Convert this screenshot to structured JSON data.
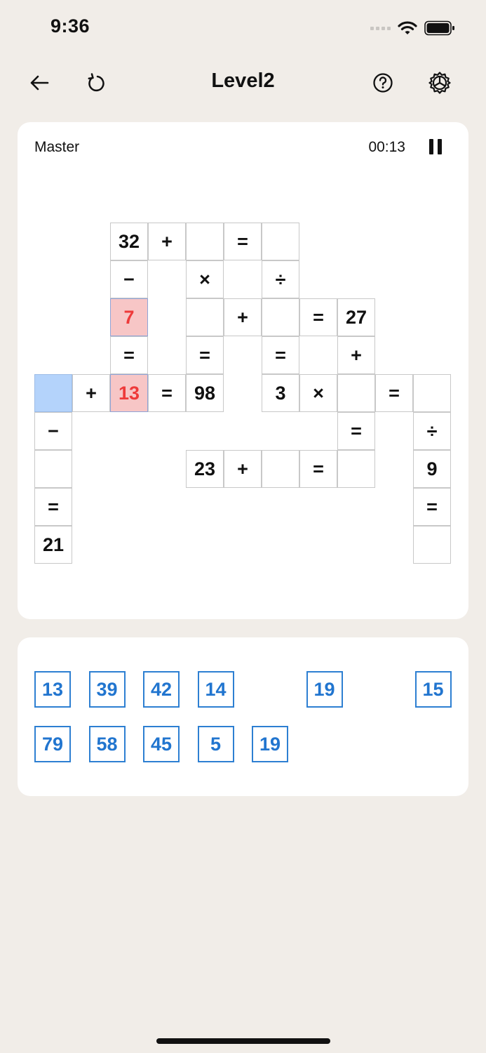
{
  "status_bar": {
    "time": "9:36"
  },
  "header": {
    "title": "Level2"
  },
  "game": {
    "difficulty": "Master",
    "timer": "00:13"
  },
  "board": [
    {
      "id": "r0c2",
      "v": "32",
      "s": ""
    },
    {
      "id": "r0c3",
      "v": "+",
      "s": ""
    },
    {
      "id": "r0c4",
      "v": "",
      "s": ""
    },
    {
      "id": "r0c5",
      "v": "=",
      "s": ""
    },
    {
      "id": "r0c6",
      "v": "",
      "s": ""
    },
    {
      "id": "r1c2",
      "v": "−",
      "s": ""
    },
    {
      "id": "r1c4",
      "v": "×",
      "s": ""
    },
    {
      "id": "r1c6",
      "v": "÷",
      "s": ""
    },
    {
      "id": "r2c2",
      "v": "7",
      "s": "err"
    },
    {
      "id": "r2c4",
      "v": "",
      "s": ""
    },
    {
      "id": "r2c5",
      "v": "+",
      "s": ""
    },
    {
      "id": "r2c6",
      "v": "",
      "s": ""
    },
    {
      "id": "r2c7",
      "v": "=",
      "s": ""
    },
    {
      "id": "r2c8",
      "v": "27",
      "s": ""
    },
    {
      "id": "r3c2",
      "v": "=",
      "s": ""
    },
    {
      "id": "r3c4",
      "v": "=",
      "s": ""
    },
    {
      "id": "r3c6",
      "v": "=",
      "s": ""
    },
    {
      "id": "r3c8",
      "v": "+",
      "s": ""
    },
    {
      "id": "r4c0",
      "v": "",
      "s": "sel"
    },
    {
      "id": "r4c1",
      "v": "+",
      "s": ""
    },
    {
      "id": "r4c2",
      "v": "13",
      "s": "err"
    },
    {
      "id": "r4c3",
      "v": "=",
      "s": ""
    },
    {
      "id": "r4c4",
      "v": "98",
      "s": ""
    },
    {
      "id": "r4c6",
      "v": "3",
      "s": ""
    },
    {
      "id": "r4c7",
      "v": "×",
      "s": ""
    },
    {
      "id": "r4c8",
      "v": "",
      "s": ""
    },
    {
      "id": "r4c9",
      "v": "=",
      "s": ""
    },
    {
      "id": "r4c10",
      "v": "",
      "s": ""
    },
    {
      "id": "r5c0",
      "v": "−",
      "s": ""
    },
    {
      "id": "r5c8",
      "v": "=",
      "s": ""
    },
    {
      "id": "r5c10",
      "v": "÷",
      "s": ""
    },
    {
      "id": "r6c0",
      "v": "",
      "s": ""
    },
    {
      "id": "r6c4",
      "v": "23",
      "s": ""
    },
    {
      "id": "r6c5",
      "v": "+",
      "s": ""
    },
    {
      "id": "r6c6",
      "v": "",
      "s": ""
    },
    {
      "id": "r6c7",
      "v": "=",
      "s": ""
    },
    {
      "id": "r6c8",
      "v": "",
      "s": ""
    },
    {
      "id": "r6c10",
      "v": "9",
      "s": ""
    },
    {
      "id": "r7c0",
      "v": "=",
      "s": ""
    },
    {
      "id": "r7c10",
      "v": "=",
      "s": ""
    },
    {
      "id": "r8c0",
      "v": "21",
      "s": ""
    },
    {
      "id": "r8c10",
      "v": "",
      "s": ""
    }
  ],
  "pool": [
    {
      "id": "p0",
      "v": "13"
    },
    {
      "id": "p1",
      "v": "39"
    },
    {
      "id": "p2",
      "v": "42"
    },
    {
      "id": "p3",
      "v": "14"
    },
    {
      "id": "p5",
      "v": "19"
    },
    {
      "id": "p7",
      "v": "15"
    },
    {
      "id": "p8",
      "v": "79"
    },
    {
      "id": "p9",
      "v": "58"
    },
    {
      "id": "p10",
      "v": "45"
    },
    {
      "id": "p11",
      "v": "5"
    },
    {
      "id": "p12",
      "v": "19"
    }
  ],
  "icons": {
    "back": "arrow-left-icon",
    "restart": "restart-icon",
    "help": "help-icon",
    "settings": "gear-icon",
    "pause": "pause-icon"
  },
  "colors": {
    "background": "#f1ede8",
    "error_cell": "#f7c6c6",
    "error_text": "#ee3a3a",
    "selected_cell": "#b4d3fb",
    "tile_blue": "#2175cf"
  }
}
